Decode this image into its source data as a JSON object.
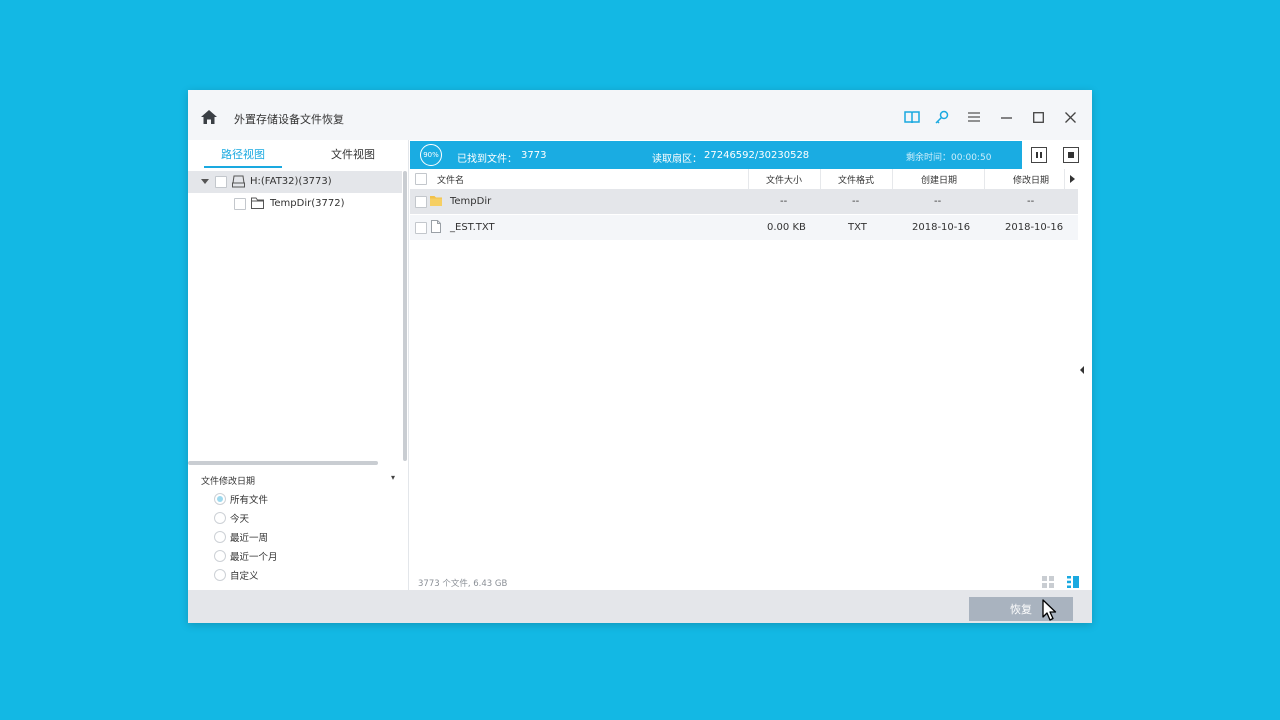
{
  "app": {
    "title": "外置存储设备文件恢复"
  },
  "tabs": [
    {
      "label": "路径视图",
      "active": true
    },
    {
      "label": "文件视图",
      "active": false
    }
  ],
  "tree": [
    {
      "label": "H:(FAT32)(3773)",
      "icon": "drive-icon",
      "expanded": true
    },
    {
      "label": "TempDir(3772)",
      "icon": "folder-outline-icon"
    }
  ],
  "filter": {
    "title": "文件修改日期",
    "options": [
      "所有文件",
      "今天",
      "最近一周",
      "最近一个月",
      "自定义"
    ],
    "selected": "所有文件"
  },
  "scan": {
    "percent": "90%",
    "found_label": "已找到文件：",
    "found_value": "3773",
    "sector_label": "读取扇区：",
    "sector_value": "27246592/30230528",
    "remaining": "剩余时间：00:00:50"
  },
  "table": {
    "headers": {
      "name": "文件名",
      "size": "文件大小",
      "format": "文件格式",
      "created": "创建日期",
      "modified": "修改日期"
    },
    "rows": [
      {
        "name": "TempDir",
        "icon": "folder-icon",
        "size": "--",
        "format": "--",
        "created": "--",
        "modified": "--"
      },
      {
        "name": "_EST.TXT",
        "icon": "file-icon",
        "size": "0.00 KB",
        "format": "TXT",
        "created": "2018-10-16",
        "modified": "2018-10-16"
      }
    ]
  },
  "status": {
    "summary": "3773 个文件, 6.43 GB"
  },
  "actions": {
    "recover_label": "恢复"
  },
  "colors": {
    "background": "#13b8e4",
    "accent": "#1aace2",
    "selected_row": "#e4e6ea"
  }
}
